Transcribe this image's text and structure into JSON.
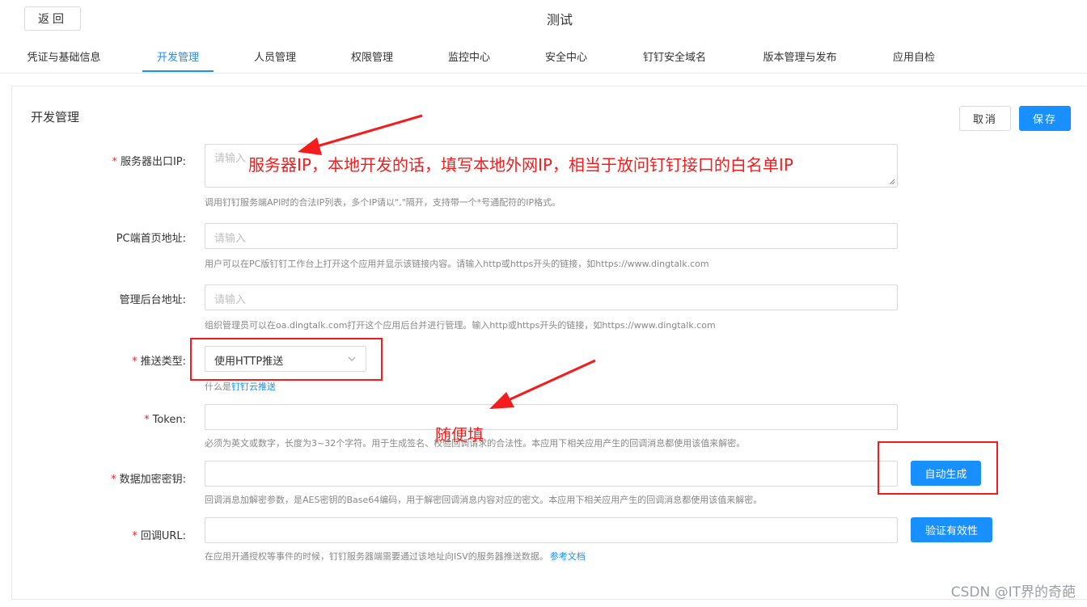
{
  "header": {
    "back_label": "返回",
    "title": "测试"
  },
  "tabs": [
    {
      "label": "凭证与基础信息",
      "active": false
    },
    {
      "label": "开发管理",
      "active": true
    },
    {
      "label": "人员管理",
      "active": false
    },
    {
      "label": "权限管理",
      "active": false
    },
    {
      "label": "监控中心",
      "active": false
    },
    {
      "label": "安全中心",
      "active": false
    },
    {
      "label": "钉钉安全域名",
      "active": false
    },
    {
      "label": "版本管理与发布",
      "active": false
    },
    {
      "label": "应用自检",
      "active": false
    }
  ],
  "section": {
    "title": "开发管理",
    "cancel_label": "取消",
    "save_label": "保存"
  },
  "form": {
    "server_ip": {
      "label": "服务器出口IP:",
      "required": true,
      "placeholder": "请输入",
      "help": "调用钉钉服务端API时的合法IP列表，多个IP请以\",\"隔开，支持带一个*号通配符的IP格式。"
    },
    "pc_home": {
      "label": "PC端首页地址:",
      "required": false,
      "placeholder": "请输入",
      "help": "用户可以在PC版钉钉工作台上打开这个应用并显示该链接内容。请输入http或https开头的链接，如https://www.dingtalk.com"
    },
    "admin_url": {
      "label": "管理后台地址:",
      "required": false,
      "placeholder": "请输入",
      "help": "组织管理员可以在oa.dingtalk.com打开这个应用后台并进行管理。输入http或https开头的链接，如https://www.dingtalk.com"
    },
    "push_type": {
      "label": "推送类型:",
      "required": true,
      "value": "使用HTTP推送",
      "help_prefix": "什么是",
      "help_link": "钉钉云推送"
    },
    "token": {
      "label": "Token:",
      "required": true,
      "help": "必须为英文或数字，长度为3~32个字符。用于生成签名、校验回调请求的合法性。本应用下相关应用产生的回调消息都使用该值来解密。"
    },
    "aes_key": {
      "label": "数据加密密钥:",
      "required": true,
      "button": "自动生成",
      "help": "回调消息加解密参数，是AES密钥的Base64编码，用于解密回调消息内容对应的密文。本应用下相关应用产生的回调消息都使用该值来解密。"
    },
    "callback_url": {
      "label": "回调URL:",
      "required": true,
      "button": "验证有效性",
      "help_prefix": "在应用开通授权等事件的时候，钉钉服务器端需要通过该地址向ISV的服务器推送数据。",
      "help_link": "参考文档"
    }
  },
  "annotations": {
    "server_ip_note": "服务器IP，本地开发的话，填写本地外网IP，相当于放问钉钉接口的白名单IP",
    "token_note": "随便填",
    "color": "#f41c1c"
  },
  "watermark": "CSDN @IT界的奇葩",
  "colors": {
    "accent": "#1890ff",
    "required": "#f5222d"
  }
}
